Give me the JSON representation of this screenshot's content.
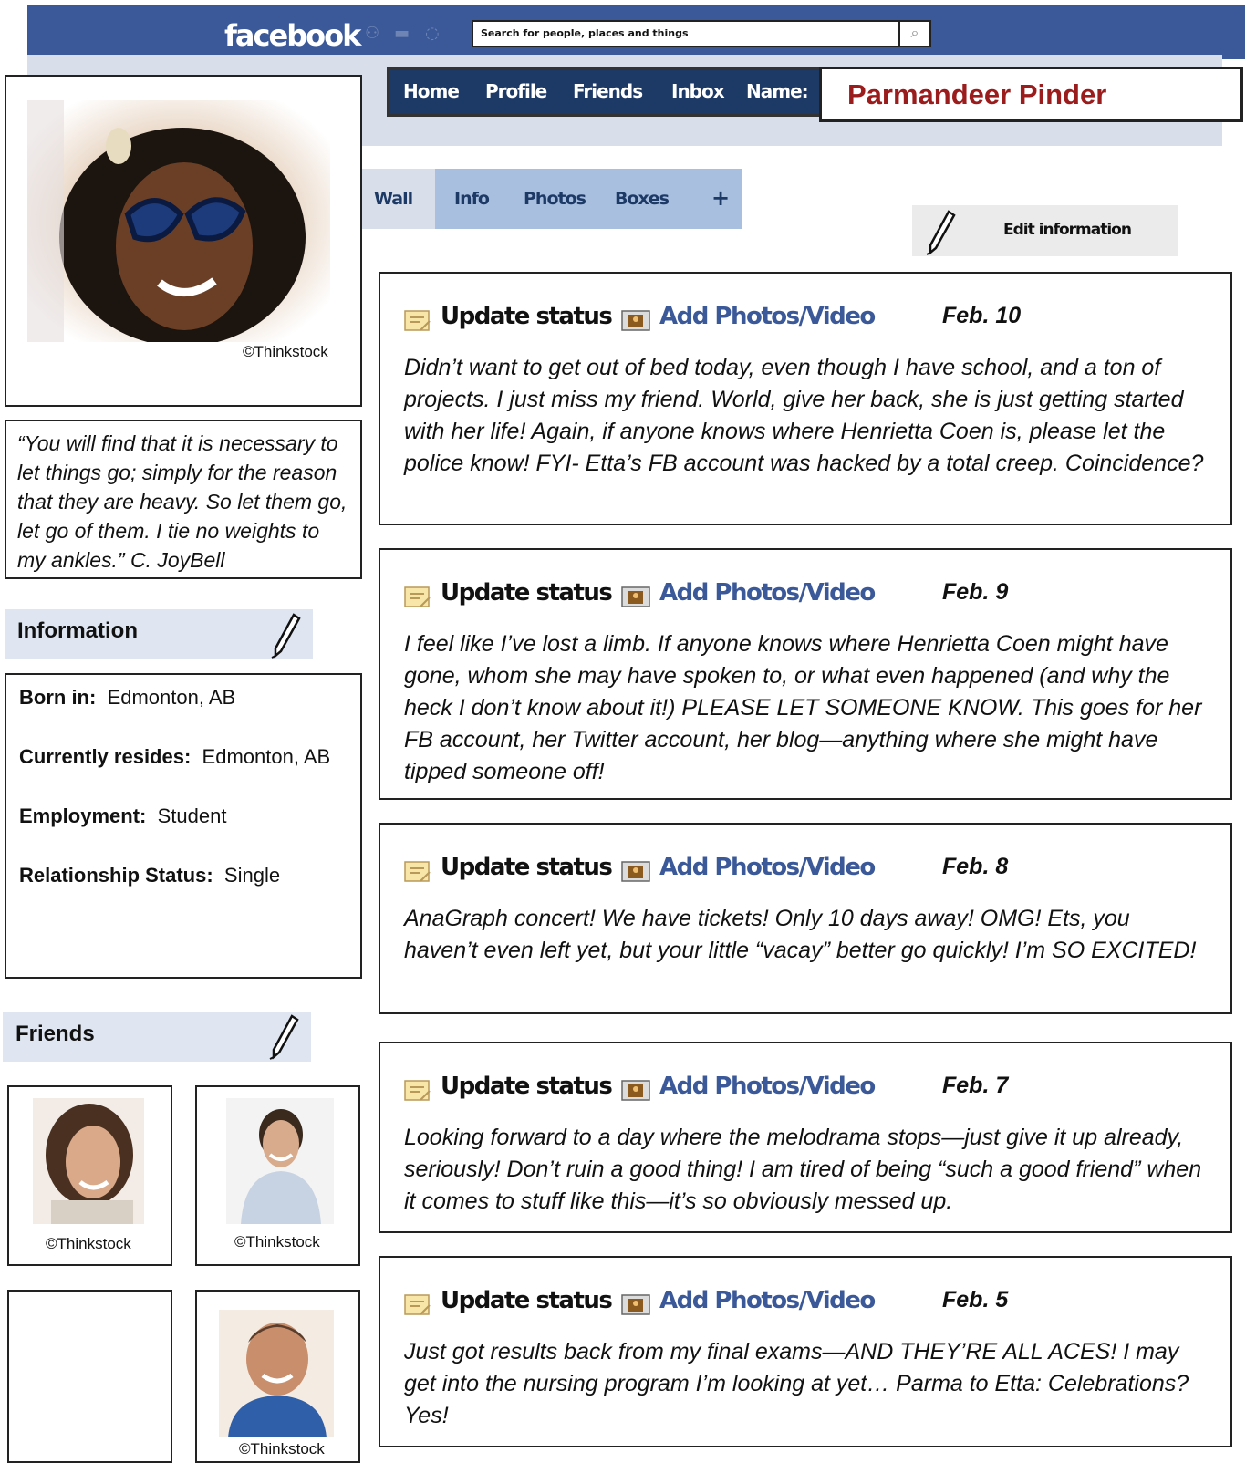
{
  "header": {
    "logo": "facebook",
    "search_placeholder": "Search for people, places and things",
    "nav": [
      "Home",
      "Profile",
      "Friends",
      "Inbox",
      "Name:"
    ],
    "profile_name": "Parmandeer Pinder"
  },
  "tabs": [
    "Wall",
    "Info",
    "Photos",
    "Boxes",
    "+"
  ],
  "edit_information": "Edit information",
  "profile": {
    "photo_credit": "©Thinkstock",
    "quote": "“You will find that it is necessary to let things go; simply for the reason that they are heavy. So let them go, let go of them.  I tie no weights to my ankles.”  C. JoyBell"
  },
  "information": {
    "title": "Information",
    "rows": [
      {
        "label": "Born in:",
        "value": "Edmonton, AB"
      },
      {
        "label": "Currently resides:",
        "value": "Edmonton, AB"
      },
      {
        "label": "Employment:",
        "value": "Student"
      },
      {
        "label": "Relationship Status:",
        "value": "Single"
      }
    ]
  },
  "friends": {
    "title": "Friends",
    "credits": [
      "©Thinkstock",
      "©Thinkstock",
      "",
      "©Thinkstock"
    ]
  },
  "post_actions": {
    "update_status": "Update status",
    "add_photos": "Add Photos/Video"
  },
  "posts": [
    {
      "date": "Feb. 10",
      "text": "Didn’t want to get out of bed today, even though I have school, and a ton of projects.  I just miss my friend.  World, give her back, she is just getting started with her life!  Again, if anyone knows where Henrietta Coen is, please let the police know! FYI- Etta’s FB account was hacked by a total creep.  Coincidence?"
    },
    {
      "date": "Feb. 9",
      "text": "I feel like I’ve lost a limb.  If anyone knows where Henrietta Coen might have gone, whom she may have spoken to, or what even happened (and why the heck I don’t know about it!)  PLEASE LET SOMEONE KNOW.  This goes for her FB account, her Twitter account, her blog—anything where she might have tipped someone off!"
    },
    {
      "date": "Feb. 8",
      "text": "AnaGraph concert!  We have tickets!  Only 10 days away! OMG!  Ets, you haven’t even left yet, but your little “vacay” better go quickly!  I’m SO EXCITED!"
    },
    {
      "date": "Feb. 7",
      "text": "Looking forward to a day where the melodrama stops—just give it up already, seriously!  Don’t ruin a good thing!  I am tired of being “such a good friend” when it comes to stuff like this—it’s so obviously messed up."
    },
    {
      "date": "Feb. 5",
      "text": "Just got results back from my final exams—AND THEY’RE ALL ACES!  I may get into the nursing program I’m looking at yet… Parma to Etta: Celebrations?  Yes!"
    }
  ]
}
